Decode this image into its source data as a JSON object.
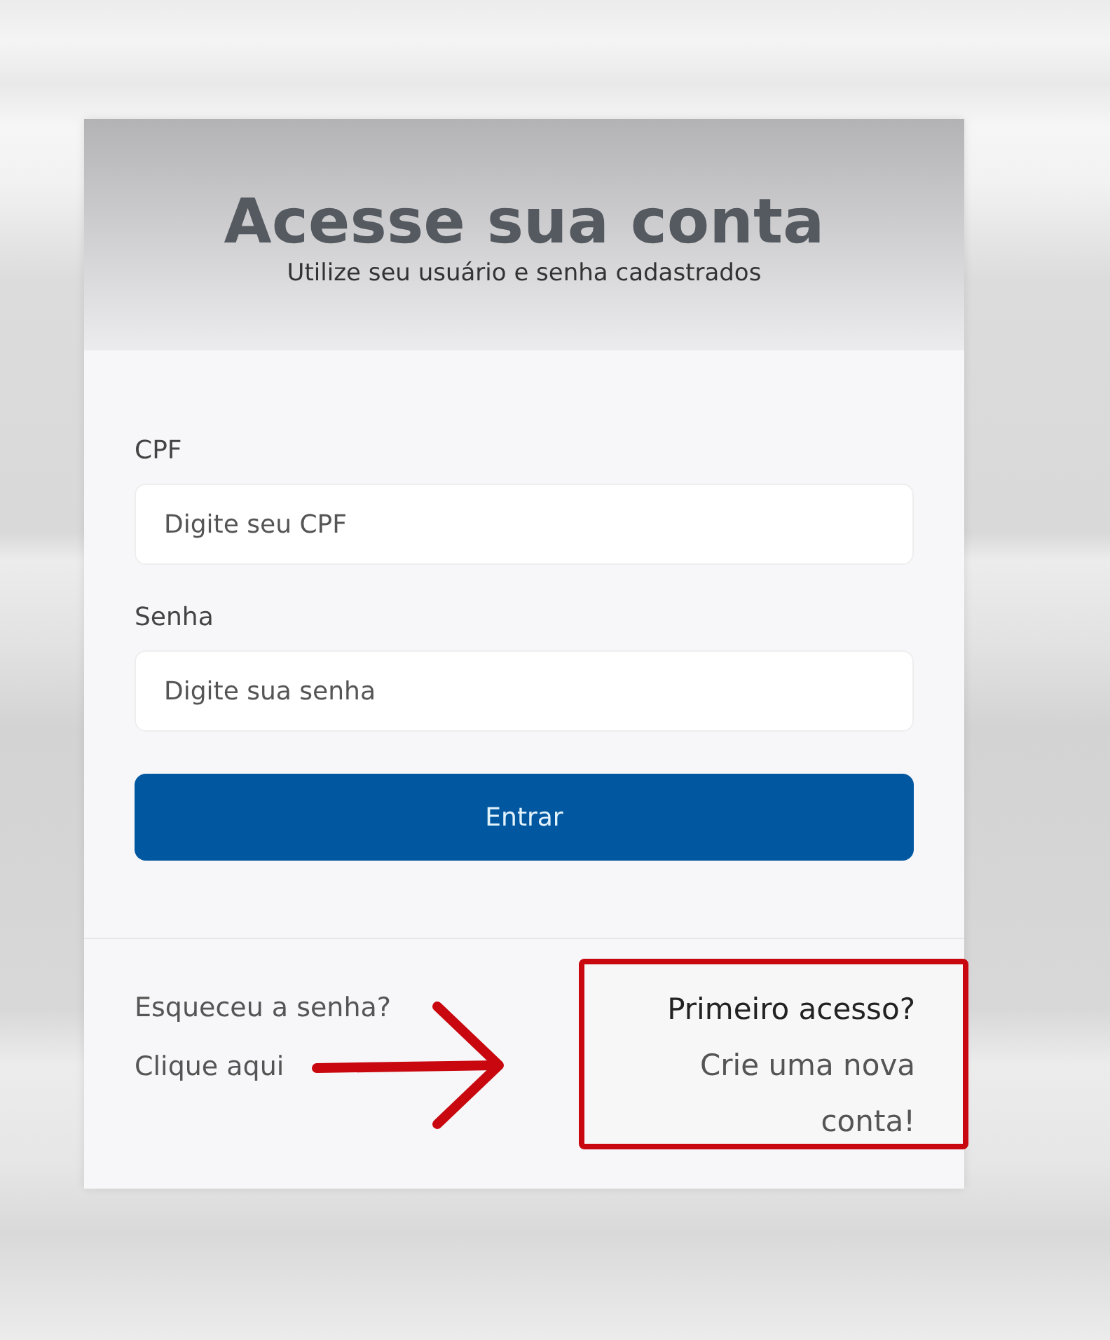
{
  "login_card": {
    "title": "Acesse sua conta",
    "subtitle": "Utilize seu usuário e senha cadastrados",
    "fields": [
      {
        "label": "CPF",
        "placeholder": "Digite seu CPF"
      },
      {
        "label": "Senha",
        "placeholder": "Digite sua senha"
      }
    ],
    "submit_button": "Entrar",
    "forgot": {
      "question": "Esqueceu a senha?",
      "link": "Clique aqui"
    },
    "first_access": {
      "question": "Primeiro acesso?",
      "link": "Crie uma nova conta!"
    }
  }
}
